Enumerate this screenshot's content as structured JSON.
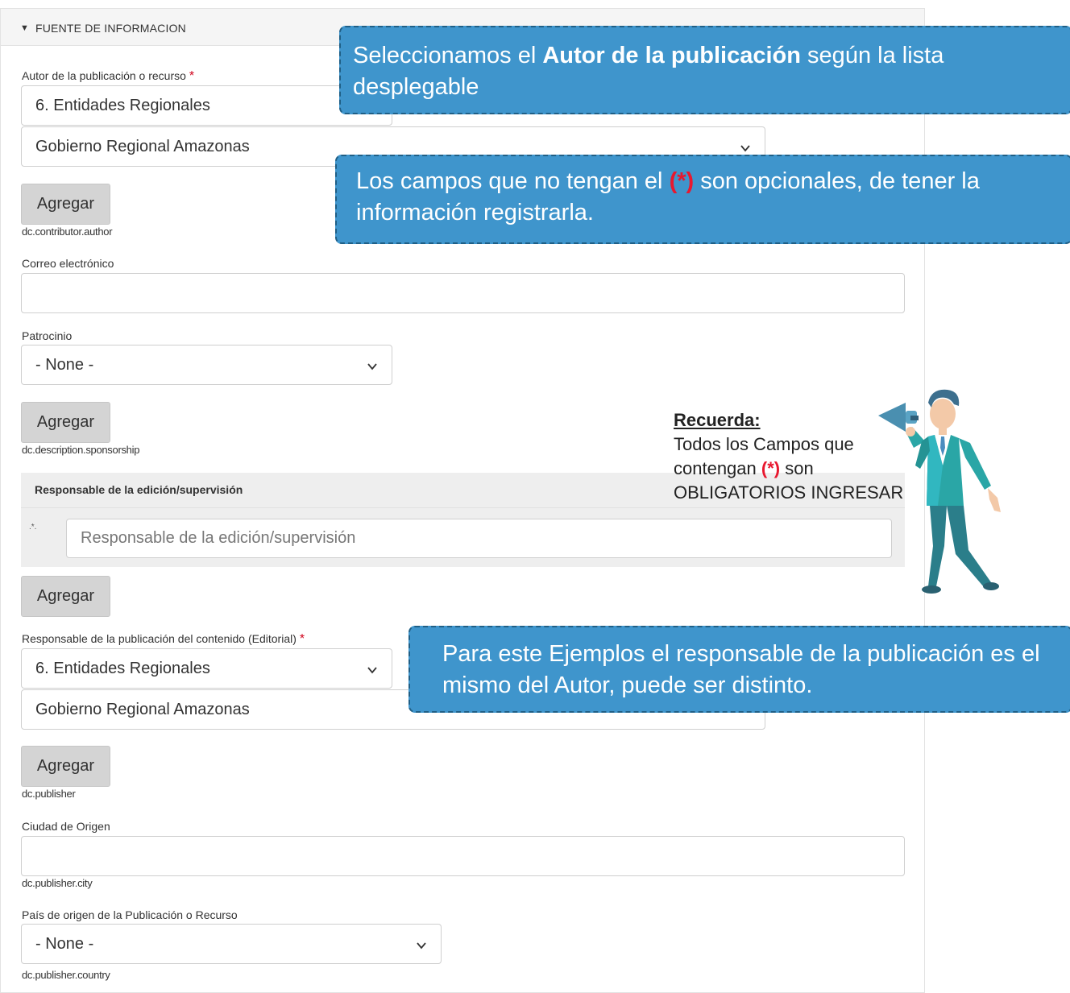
{
  "section": {
    "header_marker": "▼",
    "header_title": "FUENTE DE INFORMACION"
  },
  "author": {
    "label": "Autor de la publicación o recurso",
    "required_marker": "*",
    "select_category": "6. Entidades Regionales",
    "select_entity": "Gobierno Regional Amazonas",
    "add_label": "Agregar",
    "field_id": "dc.contributor.author"
  },
  "email": {
    "label": "Correo electrónico",
    "value": ""
  },
  "sponsorship": {
    "label": "Patrocinio",
    "selected": "- None -",
    "add_label": "Agregar",
    "field_id": "dc.description.sponsorship"
  },
  "editor": {
    "group_title": "Responsable de la edición/supervisión",
    "marker": ".*.",
    "placeholder": "Responsable de la edición/supervisión",
    "add_label": "Agregar"
  },
  "publisher": {
    "label": "Responsable de la publicación del contenido (Editorial)",
    "required_marker": "*",
    "select_category": "6. Entidades Regionales",
    "select_entity": "Gobierno Regional Amazonas",
    "add_label": "Agregar",
    "field_id": "dc.publisher"
  },
  "city": {
    "label": "Ciudad de Origen",
    "value": "",
    "field_id": "dc.publisher.city"
  },
  "country": {
    "label": "País de origen de la Publicación o Recurso",
    "selected": "- None -",
    "field_id": "dc.publisher.country"
  },
  "callouts": {
    "author": {
      "text_before": "Seleccionamos el ",
      "text_bold": "Autor de la publicación",
      "text_after": " según la lista desplegable"
    },
    "optional": {
      "text_before": "Los campos que no tengan el ",
      "asterisk": "(*)",
      "text_after": " son opcionales, de tener la información registrarla."
    },
    "publisher": {
      "text": "Para este Ejemplos el responsable de la publicación es el mismo del Autor, puede ser distinto."
    }
  },
  "reminder": {
    "heading": "Recuerda:",
    "line1": "Todos los Campos que",
    "line2_before": "contengan ",
    "asterisk": "(*)",
    "line2_after": " son",
    "line3": "OBLIGATORIOS INGRESAR"
  },
  "colors": {
    "callout_bg": "#3f95cc",
    "asterisk_red": "#e8182f",
    "button_bg": "#d4d4d4"
  }
}
